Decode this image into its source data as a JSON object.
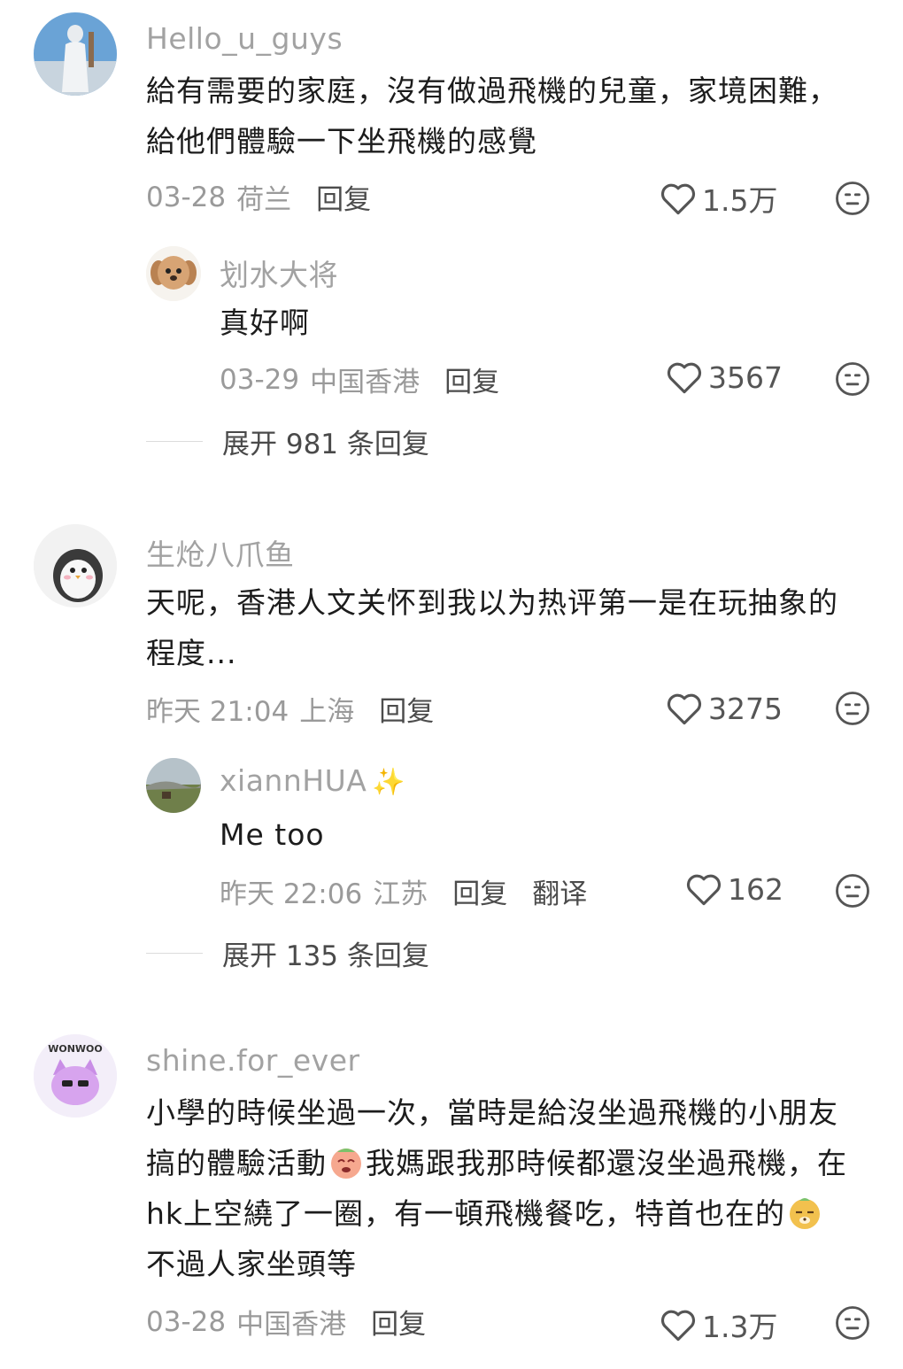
{
  "comments": [
    {
      "username": "Hello_u_guys",
      "text": "給有需要的家庭，沒有做過飛機的兒童，家境困難，給他們體驗一下坐飛機的感覺",
      "date": "03-28",
      "location": "荷兰",
      "reply_label": "回复",
      "likes": "1.5万",
      "replies": [
        {
          "username": "划水大将",
          "text": "真好啊",
          "date": "03-29",
          "location": "中国香港",
          "reply_label": "回复",
          "likes": "3567"
        }
      ],
      "expand_label": "展开 981 条回复"
    },
    {
      "username": "生炝八爪鱼",
      "text": "天呢，香港人文关怀到我以为热评第一是在玩抽象的程度...",
      "date": "昨天 21:04",
      "location": "上海",
      "reply_label": "回复",
      "likes": "3275",
      "replies": [
        {
          "username": "xiannHUA",
          "username_emoji": "✨",
          "text": "Me too",
          "date": "昨天 22:06",
          "location": "江苏",
          "reply_label": "回复",
          "translate_label": "翻译",
          "likes": "162"
        }
      ],
      "expand_label": "展开 135 条回复"
    },
    {
      "username": "shine.for_ever",
      "avatar_text": "WONWOO",
      "text_part1": "小學的時候坐過一次，當時是給沒坐過飛機的小朋友搞的體驗活動",
      "text_part2": "我媽跟我那時候都還沒坐過飛機，在hk上空繞了一圈，有一頓飛機餐吃，特首也在的",
      "text_part3": "不過人家坐頭等",
      "date": "03-28",
      "location": "中国香港",
      "reply_label": "回复",
      "likes": "1.3万"
    }
  ],
  "colors": {
    "username": "#a2a2a2",
    "text": "#1c1c1c",
    "meta": "#9a9a9a",
    "icon": "#555555"
  },
  "icons": {
    "like": "heart-outline-icon",
    "react": "neutral-face-icon"
  }
}
